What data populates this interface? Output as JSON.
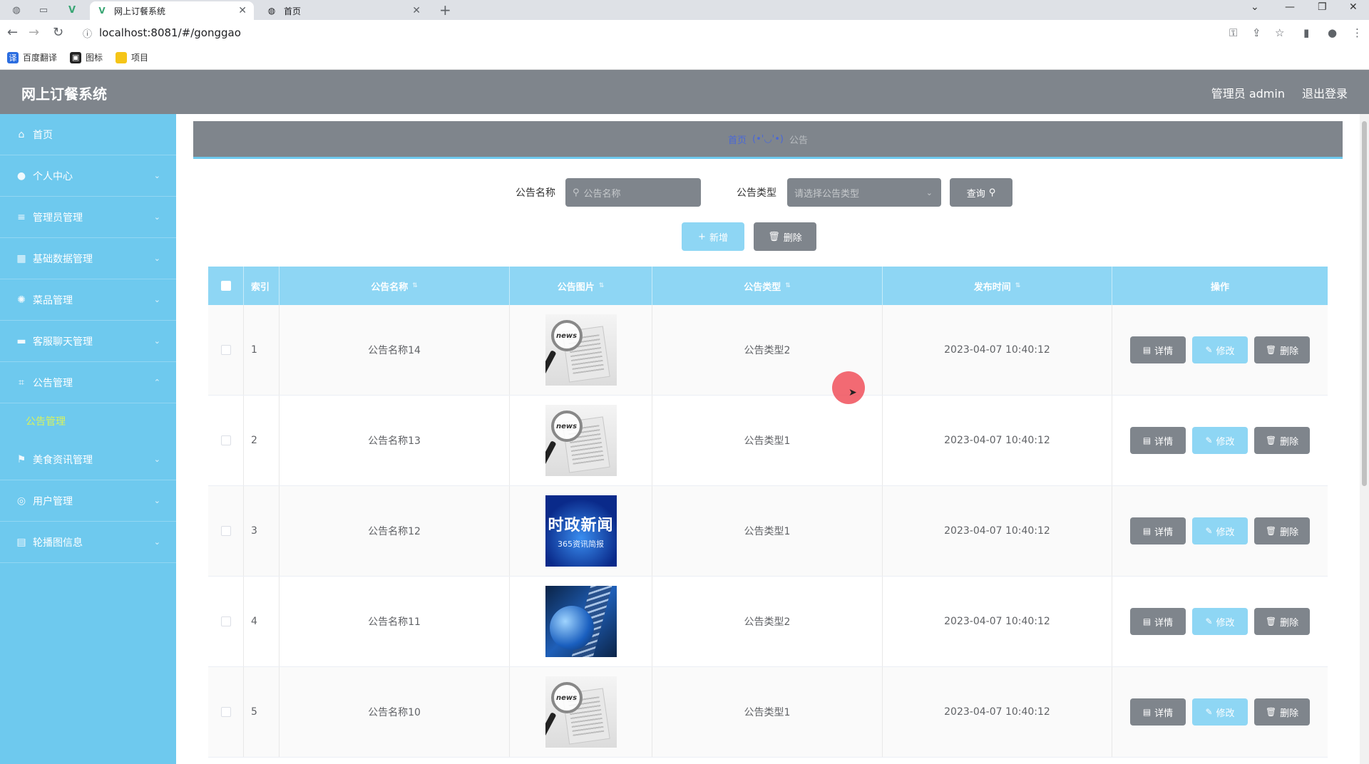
{
  "browser": {
    "tabs": [
      {
        "title": "网上订餐系统",
        "active": true
      },
      {
        "title": "首页",
        "active": false
      }
    ],
    "url": "localhost:8081/#/gonggao",
    "bookmarks": [
      "百度翻译",
      "图标",
      "项目"
    ]
  },
  "header": {
    "title": "网上订餐系统",
    "user": "管理员 admin",
    "logout": "退出登录"
  },
  "sidebar": {
    "items": [
      {
        "label": "首页",
        "icon": "home-icon"
      },
      {
        "label": "个人中心",
        "icon": "user-icon"
      },
      {
        "label": "管理员管理",
        "icon": "list-icon"
      },
      {
        "label": "基础数据管理",
        "icon": "grid-icon"
      },
      {
        "label": "菜品管理",
        "icon": "dish-icon"
      },
      {
        "label": "客服聊天管理",
        "icon": "monitor-icon"
      },
      {
        "label": "公告管理",
        "icon": "crop-icon",
        "expanded": true
      },
      {
        "label": "美食资讯管理",
        "icon": "flag-icon"
      },
      {
        "label": "用户管理",
        "icon": "compass-icon"
      },
      {
        "label": "轮播图信息",
        "icon": "clipboard-icon"
      }
    ],
    "submenu_active": "公告管理"
  },
  "breadcrumb": {
    "home": "首页",
    "sep": "(•'◡'•)",
    "current": "公告"
  },
  "search": {
    "name_label": "公告名称",
    "name_placeholder": "公告名称",
    "type_label": "公告类型",
    "type_placeholder": "请选择公告类型",
    "query_button": "查询"
  },
  "actions": {
    "add": "新增",
    "delete": "删除"
  },
  "table": {
    "columns": [
      "索引",
      "公告名称",
      "公告图片",
      "公告类型",
      "发布时间",
      "操作"
    ],
    "rows": [
      {
        "index": "1",
        "name": "公告名称14",
        "image": "news",
        "type": "公告类型2",
        "time": "2023-04-07 10:40:12"
      },
      {
        "index": "2",
        "name": "公告名称13",
        "image": "news",
        "type": "公告类型1",
        "time": "2023-04-07 10:40:12"
      },
      {
        "index": "3",
        "name": "公告名称12",
        "image": "shizheng",
        "type": "公告类型1",
        "time": "2023-04-07 10:40:12"
      },
      {
        "index": "4",
        "name": "公告名称11",
        "image": "globe",
        "type": "公告类型2",
        "time": "2023-04-07 10:40:12"
      },
      {
        "index": "5",
        "name": "公告名称10",
        "image": "news",
        "type": "公告类型1",
        "time": "2023-04-07 10:40:12"
      }
    ],
    "row_buttons": {
      "detail": "详情",
      "edit": "修改",
      "delete": "删除"
    },
    "image_text": {
      "news": "news",
      "shizheng_big": "时政新闻",
      "shizheng_small": "365资讯简报"
    }
  },
  "colors": {
    "accent": "#6ec9ee",
    "header": "#7f858c",
    "submenu_active": "#d7f25c"
  }
}
